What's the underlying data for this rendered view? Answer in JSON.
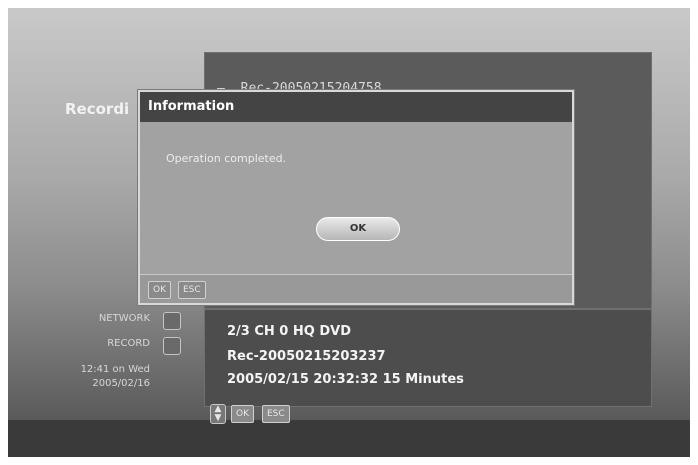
{
  "background": {
    "side_title": "Recordi",
    "file_title": "Rec-20050215204758",
    "file_dash": "—"
  },
  "dialog": {
    "title": "Information",
    "message": "Operation completed.",
    "ok_button": "OK",
    "footer_keys": [
      "OK",
      "ESC"
    ]
  },
  "status": {
    "network_label": "NETWORK",
    "record_label": "RECORD",
    "time": "12:41 on Wed",
    "date": "2005/02/16"
  },
  "info": {
    "line1": "2/3   CH  0  HQ DVD",
    "line2": "Rec-20050215203237",
    "line3": "2005/02/15 20:32:32    15 Minutes"
  },
  "bottom_keys": [
    "OK",
    "ESC"
  ],
  "icons": {
    "nav": "up-down-icon",
    "status_box": "status-indicator-icon"
  }
}
